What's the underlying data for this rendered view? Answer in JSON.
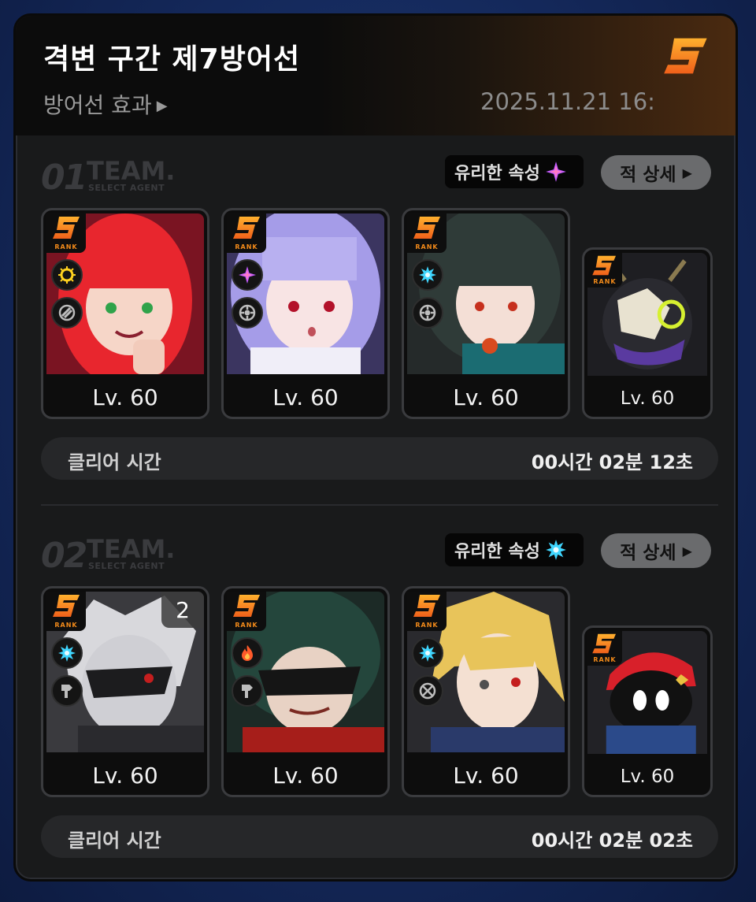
{
  "header": {
    "title": "격변 구간 제7방어선",
    "subtitle": "방어선 효과",
    "datetime": "2025.11.21 16:",
    "grade": "S"
  },
  "colors": {
    "orange": "#f28a1a",
    "panel": "#191a1b"
  },
  "teams": [
    {
      "number": "01",
      "team_word": "TEAM.",
      "team_sub": "SELECT AGENT",
      "attr_label": "유리한 속성",
      "attr_icon": "ether-icon",
      "detail_label": "적 상세",
      "members": [
        {
          "level": "Lv. 60",
          "rank": "RANK",
          "element_icon": "electric-icon",
          "type_icon": "stun-icon"
        },
        {
          "level": "Lv. 60",
          "rank": "RANK",
          "element_icon": "ether-icon",
          "type_icon": "attack-icon"
        },
        {
          "level": "Lv. 60",
          "rank": "RANK",
          "element_icon": "ice-icon",
          "type_icon": "attack-icon"
        },
        {
          "level": "Lv. 60",
          "rank": "RANK"
        }
      ],
      "clear_label": "클리어 시간",
      "clear_time": "00시간 02분 12초"
    },
    {
      "number": "02",
      "team_word": "TEAM.",
      "team_sub": "SELECT AGENT",
      "attr_label": "유리한 속성",
      "attr_icon": "ice-icon",
      "detail_label": "적 상세",
      "members": [
        {
          "level": "Lv. 60",
          "rank": "RANK",
          "element_icon": "ice-icon",
          "type_icon": "defense-icon",
          "constellation": "2"
        },
        {
          "level": "Lv. 60",
          "rank": "RANK",
          "element_icon": "fire-icon",
          "type_icon": "defense-icon"
        },
        {
          "level": "Lv. 60",
          "rank": "RANK",
          "element_icon": "ice-icon",
          "type_icon": "anomaly-icon"
        },
        {
          "level": "Lv. 60",
          "rank": "RANK"
        }
      ],
      "clear_label": "클리어 시간",
      "clear_time": "00시간 02분 02초"
    }
  ]
}
